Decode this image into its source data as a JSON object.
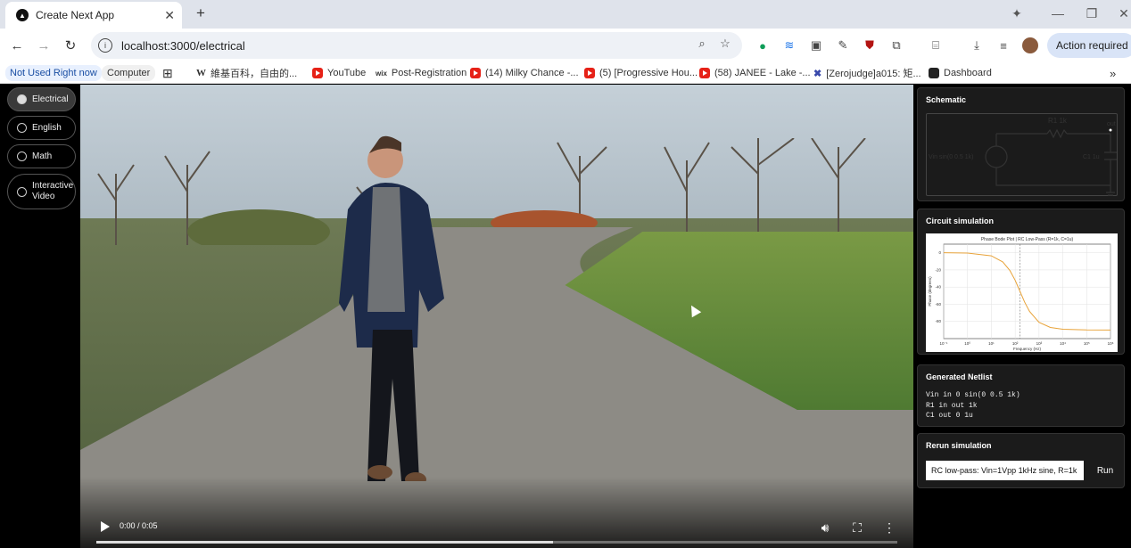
{
  "browser": {
    "tab_title": "Create Next App",
    "new_tab_symbol": "+",
    "url": "localhost:3000/electrical",
    "action_label": "Action required",
    "bookmarks": [
      {
        "label": "Not Used Right now",
        "icon": "none"
      },
      {
        "label": "Computer",
        "icon": "none"
      },
      {
        "label": "維基百科，自由的...",
        "icon": "wikipedia-icon"
      },
      {
        "label": "YouTube",
        "icon": "youtube-icon"
      },
      {
        "label": "Post-Registration",
        "icon": "wix-icon"
      },
      {
        "label": "(14) Milky Chance -...",
        "icon": "youtube-icon"
      },
      {
        "label": "(5) [Progressive Hou...",
        "icon": "youtube-icon"
      },
      {
        "label": "(58) JANEE - Lake -...",
        "icon": "youtube-icon"
      },
      {
        "label": "[Zerojudge]a015: 矩...",
        "icon": "zerojudge-icon"
      },
      {
        "label": "Dashboard",
        "icon": "dashboard-icon"
      }
    ]
  },
  "sidebar": {
    "items": [
      {
        "label": "Electrical",
        "active": true
      },
      {
        "label": "English",
        "active": false
      },
      {
        "label": "Math",
        "active": false
      },
      {
        "label": "Interactive Video",
        "active": false
      }
    ]
  },
  "video": {
    "timecode": "0:00 / 0:05",
    "progress_fraction": 0.57
  },
  "schematic": {
    "heading": "Schematic",
    "r_label": "R1 1k",
    "out_label": "out",
    "vin_label": "Vin  sin(0 0.5 1k)",
    "c_label": "C1  1u"
  },
  "simulation": {
    "heading": "Circuit simulation"
  },
  "netlist": {
    "heading": "Generated Netlist",
    "lines": [
      "Vin in 0 sin(0 0.5 1k)",
      "R1 in out 1k",
      "C1 out 0 1u"
    ]
  },
  "rerun": {
    "heading": "Rerun simulation",
    "input_value": "RC low-pass: Vin=1Vpp 1kHz sine, R=1k",
    "button_label": "Run"
  },
  "chart_data": {
    "type": "line",
    "title": "Phase Bode Plot | RC Low-Pass (R=1k, C=1u)",
    "xlabel": "Frequency (Hz)",
    "ylabel": "Phase (degrees)",
    "xscale": "log",
    "xlim": [
      0.1,
      1000000
    ],
    "ylim": [
      -100,
      10
    ],
    "x_ticks": [
      "10⁻¹",
      "10⁰",
      "10¹",
      "10²",
      "10³",
      "10⁴",
      "10⁵",
      "10⁶"
    ],
    "y_ticks": [
      0,
      -20,
      -40,
      -60,
      -80
    ],
    "cutoff_hz": 159,
    "grid": true,
    "series": [
      {
        "color": "#e8a33a",
        "x": [
          0.1,
          1,
          10,
          30,
          60,
          100,
          159,
          250,
          400,
          1000,
          3000,
          10000,
          100000,
          1000000
        ],
        "y": [
          -0.04,
          -0.36,
          -3.6,
          -10.7,
          -20.7,
          -32.1,
          -45.0,
          -57.5,
          -68.3,
          -81.0,
          -87.0,
          -89.1,
          -89.9,
          -90.0
        ]
      }
    ]
  }
}
